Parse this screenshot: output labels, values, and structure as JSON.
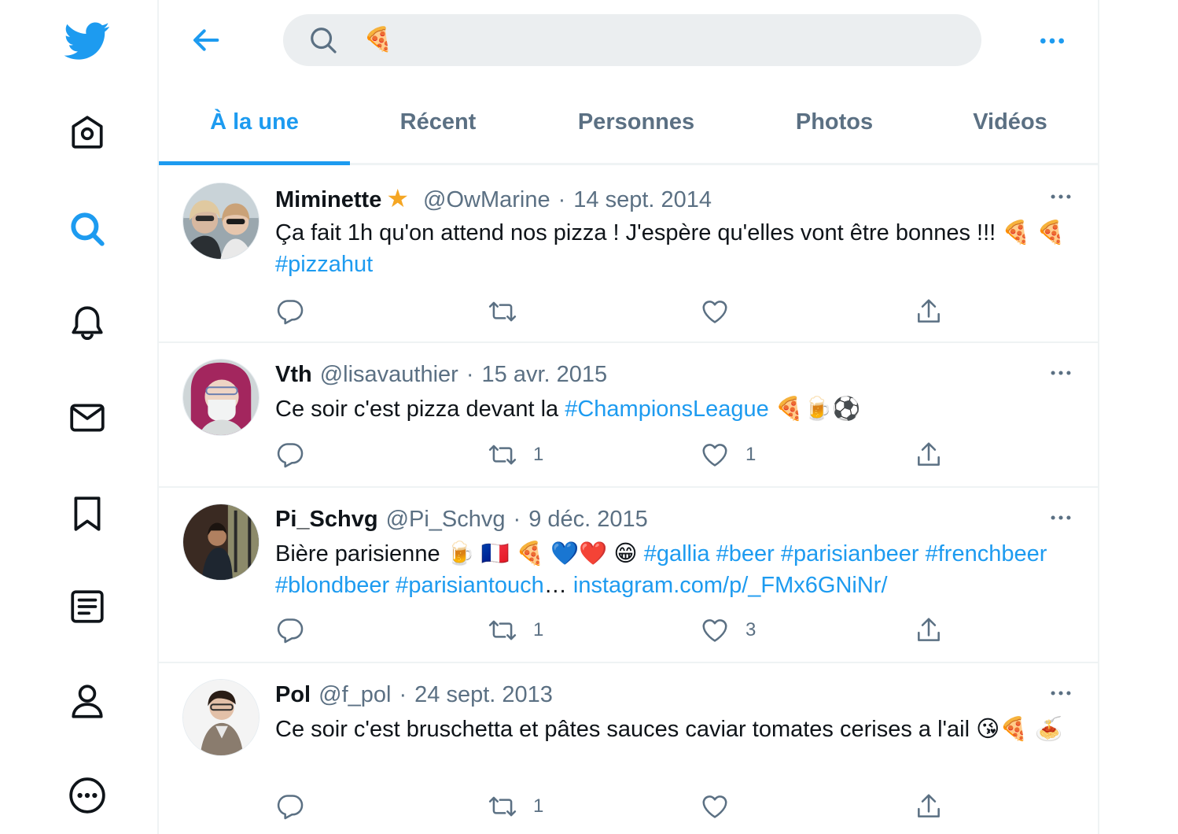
{
  "search": {
    "query": "🍕"
  },
  "tabs": [
    {
      "label": "À la une"
    },
    {
      "label": "Récent"
    },
    {
      "label": "Personnes"
    },
    {
      "label": "Photos"
    },
    {
      "label": "Vidéos"
    }
  ],
  "colors": {
    "accent": "#1d9bf0",
    "secondary": "#5b7083",
    "text": "#0f1419",
    "search_bg": "#ebeef0"
  },
  "nav_icons": [
    "twitter-logo-icon",
    "home-icon",
    "explore-search-icon",
    "notifications-bell-icon",
    "messages-envelope-icon",
    "bookmarks-icon",
    "lists-icon",
    "profile-icon",
    "more-icon"
  ],
  "tweets": [
    {
      "name": "Miminette",
      "badge": "★",
      "handle": "@OwMarine",
      "sep": "·",
      "date": "14 sept. 2014",
      "text_parts": [
        {
          "t": "Ça fait 1h qu'on attend nos pizza ! J'espère qu'elles vont être bonnes !!! 🍕 🍕 "
        },
        {
          "t": "#pizzahut",
          "hl": true
        }
      ],
      "reply_count": "",
      "retweet_count": "",
      "like_count": ""
    },
    {
      "name": "Vth",
      "handle": "@lisavauthier",
      "sep": "·",
      "date": "15 avr. 2015",
      "text_parts": [
        {
          "t": "Ce soir c'est pizza devant la "
        },
        {
          "t": "#ChampionsLeague",
          "hl": true
        },
        {
          "t": " 🍕🍺⚽"
        }
      ],
      "reply_count": "",
      "retweet_count": "1",
      "like_count": "1"
    },
    {
      "name": "Pi_Schvg",
      "handle": "@Pi_Schvg",
      "sep": "·",
      "date": "9 déc. 2015",
      "text_parts": [
        {
          "t": "Bière parisienne 🍺 🇫🇷 🍕 💙❤️ 😁 "
        },
        {
          "t": "#gallia #beer #parisianbeer #frenchbeer #blondbeer #parisiantouch",
          "hl": true
        },
        {
          "t": "… "
        },
        {
          "t": "instagram.com/p/_FMx6GNiNr/",
          "hl": true
        }
      ],
      "reply_count": "",
      "retweet_count": "1",
      "like_count": "3"
    },
    {
      "name": "Pol",
      "handle": "@f_pol",
      "sep": "·",
      "date": "24 sept. 2013",
      "text_parts": [
        {
          "t": "Ce soir c'est bruschetta et pâtes sauces caviar tomates cerises a l'ail 😘🍕 🍝"
        }
      ],
      "reply_count": "",
      "retweet_count": "1",
      "like_count": ""
    }
  ]
}
